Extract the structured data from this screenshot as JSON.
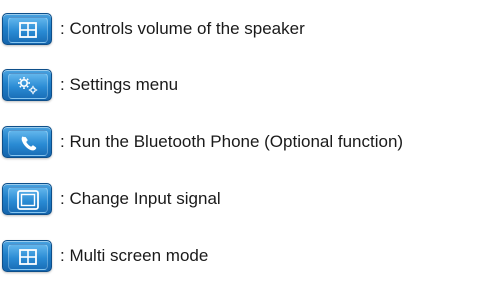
{
  "items": [
    {
      "icon": "multi-screen-grid-icon",
      "label": ": Controls volume of the speaker"
    },
    {
      "icon": "settings-gears-icon",
      "label": ": Settings menu"
    },
    {
      "icon": "phone-handset-icon",
      "label": ": Run the Bluetooth Phone (Optional function)"
    },
    {
      "icon": "input-signal-screen-icon",
      "label": ": Change Input signal"
    },
    {
      "icon": "multi-screen-grid-icon",
      "label": ": Multi screen mode"
    }
  ],
  "colors": {
    "button_blue": "#1f7fc8",
    "glyph_white": "#ffffff",
    "text": "#1a1a1a"
  }
}
